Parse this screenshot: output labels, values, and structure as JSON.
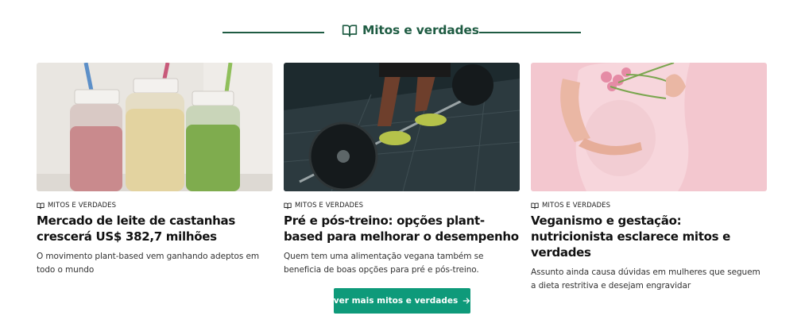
{
  "section": {
    "title": "Mitos e verdades",
    "icon": "open-book-icon",
    "accent_color": "#1f5c43"
  },
  "cards": [
    {
      "category": "MITOS E VERDADES",
      "title": "Mercado de leite de castanhas crescerá US$ 382,7 milhões",
      "description": "O movimento plant-based vem ganhando adeptos em todo o mundo",
      "image": "plant-milk-bottles-image"
    },
    {
      "category": "MITOS E VERDADES",
      "title": "Pré e pós-treino: opções plant-based para melhorar o desempenho",
      "description": "Quem tem uma alimentação vegana também se beneficia de boas opções para pré e pós-treino.",
      "image": "weightlifting-image"
    },
    {
      "category": "MITOS E VERDADES",
      "title": "Veganismo e gestação: nutricionista esclarece mitos e verdades",
      "description": "Assunto ainda causa dúvidas em mulheres que seguem a dieta restritiva e desejam engravidar",
      "image": "pregnant-woman-flowers-image"
    }
  ],
  "cta": {
    "label": "ver mais mitos e verdades",
    "icon": "arrow-right-icon",
    "color": "#0e9a7a"
  }
}
